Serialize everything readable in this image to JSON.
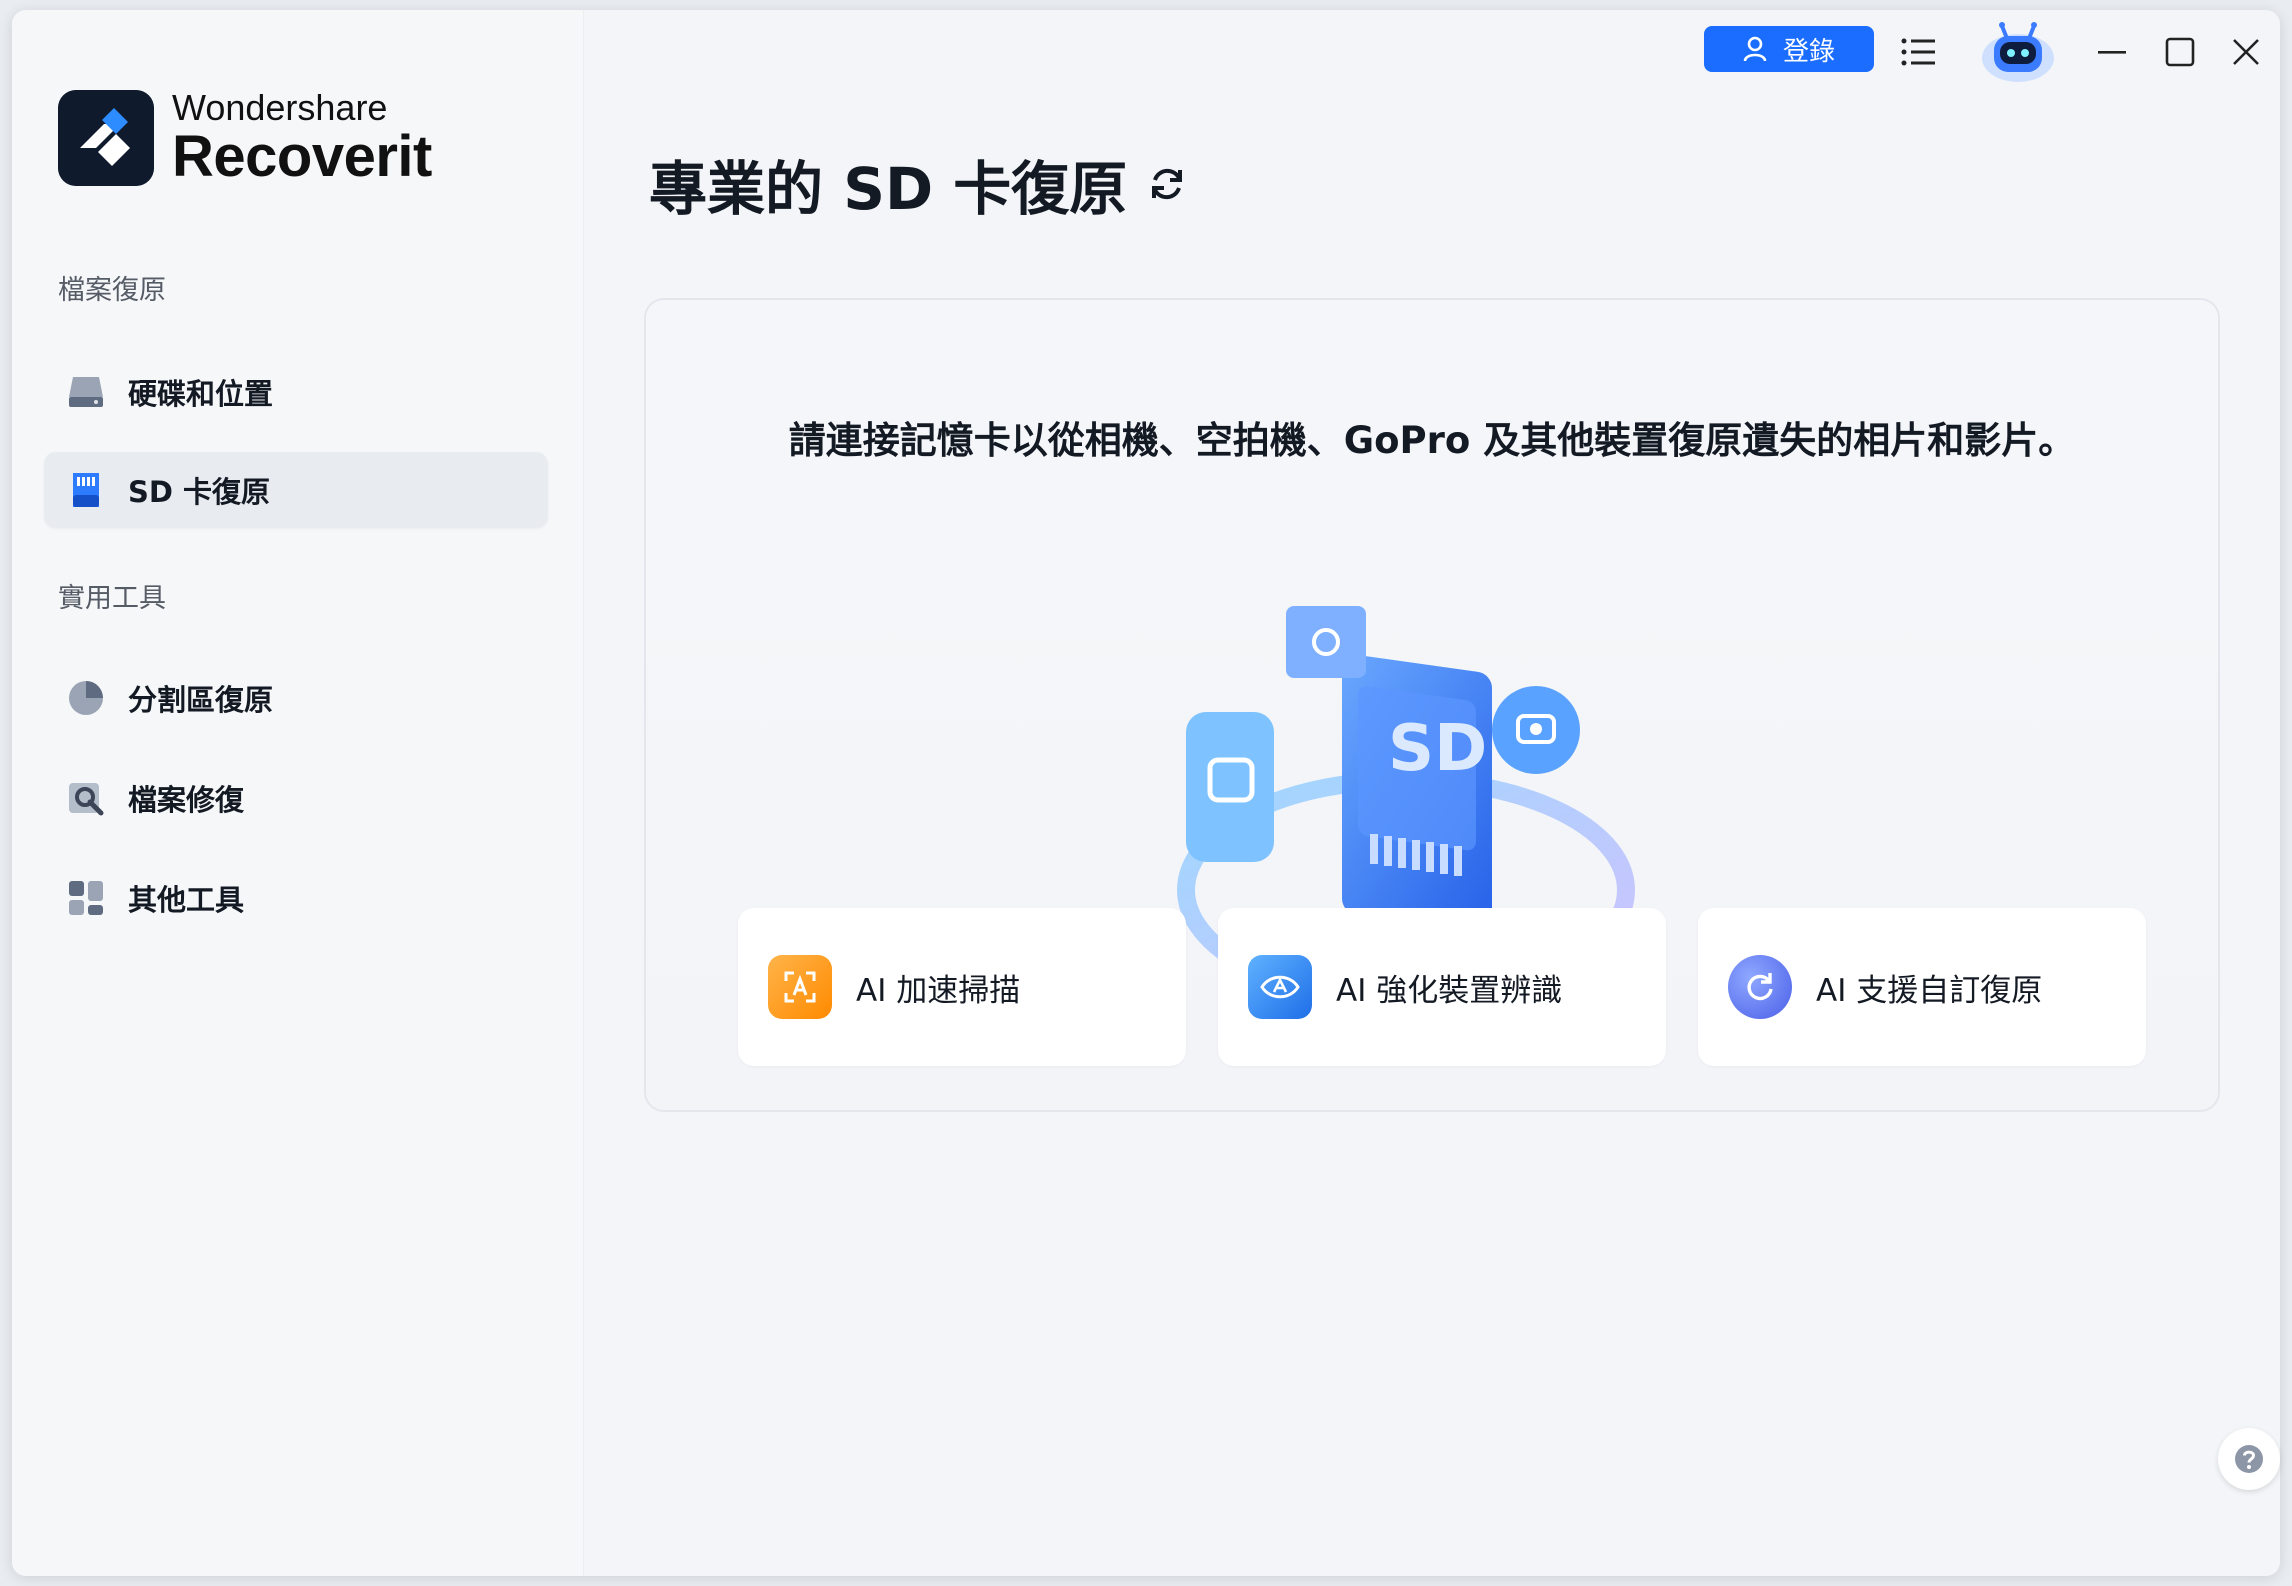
{
  "brand": {
    "company": "Wondershare",
    "product": "Recoverit"
  },
  "sidebar": {
    "sections": [
      {
        "label": "檔案復原"
      },
      {
        "label": "實用工具"
      }
    ],
    "items": [
      {
        "label": "硬碟和位置",
        "icon": "hard-drive-icon"
      },
      {
        "label": "SD 卡復原",
        "icon": "sd-card-icon",
        "active": true
      },
      {
        "label": "分割區復原",
        "icon": "pie-chart-icon"
      },
      {
        "label": "檔案修復",
        "icon": "file-repair-icon"
      },
      {
        "label": "其他工具",
        "icon": "grid-tools-icon"
      }
    ]
  },
  "titlebar": {
    "login_label": "登錄",
    "icons": [
      "user-icon",
      "menu-icon",
      "robot-assistant-icon",
      "minimize-icon",
      "maximize-icon",
      "close-icon"
    ]
  },
  "main": {
    "title": "專業的 SD 卡復原",
    "instruction": "請連接記憶卡以從相機、空拍機、GoPro 及其他裝置復原遺失的相片和影片。",
    "illustration_text": "SD",
    "features": [
      {
        "label": "AI 加速掃描",
        "icon": "ai-scan-icon",
        "color": "#ff9a1f"
      },
      {
        "label": "AI 強化裝置辨識",
        "icon": "ai-eye-icon",
        "color": "#2f86f0"
      },
      {
        "label": "AI 支援自訂復原",
        "icon": "ai-restore-icon",
        "color": "#5b6cf2"
      }
    ]
  },
  "colors": {
    "accent": "#1a6dff",
    "text": "#141a24",
    "sidebar_bg": "#f6f7f9",
    "active_item": "#e8ebf0"
  }
}
